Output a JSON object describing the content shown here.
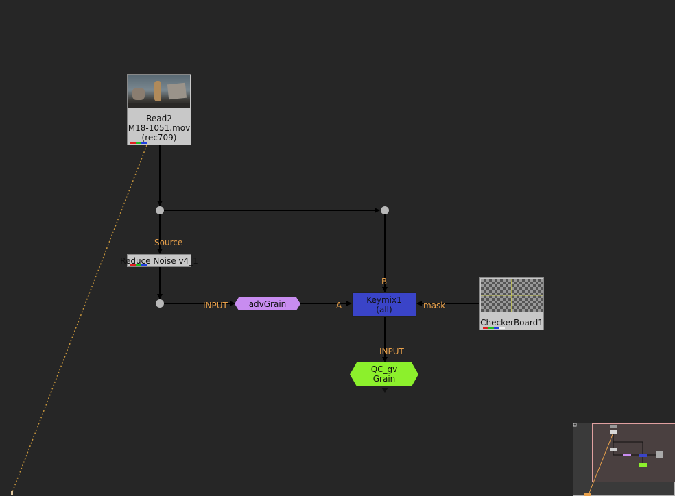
{
  "read_node": {
    "name": "Read2",
    "file": "M18-1051.mov",
    "colorspace": "(rec709)"
  },
  "reduce_noise_node": {
    "label": "Reduce Noise v4_1",
    "input_label": "Source"
  },
  "advgrain_node": {
    "label": "advGrain",
    "input_label": "INPUT"
  },
  "keymix_node": {
    "name": "Keymix1",
    "sub": "(all)",
    "input_a": "A",
    "input_b": "B",
    "input_mask": "mask"
  },
  "checker_node": {
    "label": "CheckerBoard1"
  },
  "qc_node": {
    "line1": "QC_gv",
    "line2": "Grain",
    "input_label": "INPUT"
  },
  "colors": {
    "background": "#262626",
    "edge_label": "#e8a04a",
    "keymix": "#3a44c8",
    "advgrain": "#c88cf0",
    "qc": "#8cf02c",
    "dot": "#b8b8b8"
  },
  "minimap": {
    "visible": true
  }
}
